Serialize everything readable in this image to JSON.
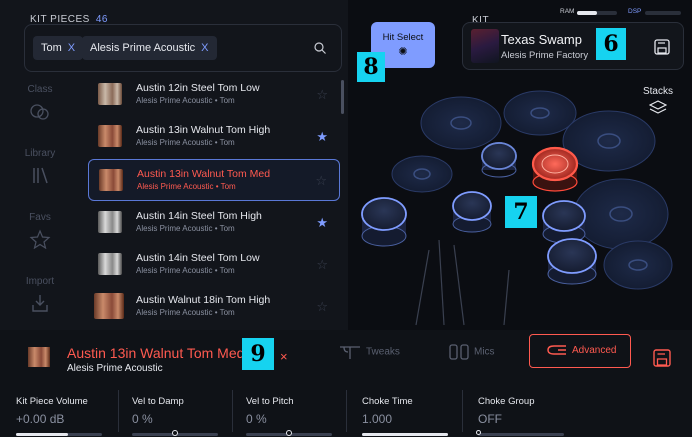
{
  "kit_pieces": {
    "header": "KIT PIECES",
    "count": "46",
    "filters": [
      {
        "label": "Tom",
        "remove": "X"
      },
      {
        "label": "Alesis Prime Acoustic",
        "remove": "X"
      }
    ],
    "sidebar": [
      {
        "label": "Class",
        "icon": "class-icon"
      },
      {
        "label": "Library",
        "icon": "library-icon"
      },
      {
        "label": "Favs",
        "icon": "star-outline-icon"
      },
      {
        "label": "Import",
        "icon": "import-icon"
      }
    ],
    "items": [
      {
        "name": "Austin 12in Steel Tom Low",
        "sub": "Alesis Prime Acoustic • Tom",
        "fav": false,
        "selected": false
      },
      {
        "name": "Austin 13in Walnut Tom High",
        "sub": "Alesis Prime Acoustic • Tom",
        "fav": true,
        "selected": false
      },
      {
        "name": "Austin 13in Walnut Tom Med",
        "sub": "Alesis Prime Acoustic • Tom",
        "fav": false,
        "selected": true
      },
      {
        "name": "Austin 14in Steel Tom High",
        "sub": "Alesis Prime Acoustic • Tom",
        "fav": true,
        "selected": false
      },
      {
        "name": "Austin 14in Steel Tom Low",
        "sub": "Alesis Prime Acoustic • Tom",
        "fav": false,
        "selected": false
      },
      {
        "name": "Austin Walnut 18in Tom High",
        "sub": "Alesis Prime Acoustic • Tom",
        "fav": false,
        "selected": false
      }
    ]
  },
  "hit_select": {
    "label": "Hit Select",
    "icon": "target-icon"
  },
  "kit": {
    "header": "KIT",
    "name": "Texas Swamp",
    "sub": "Alesis Prime Factory"
  },
  "meters": {
    "ram": "RAM",
    "ram_level": 0.5,
    "dsp": "DSP"
  },
  "stacks": {
    "label": "Stacks"
  },
  "badges": {
    "b6": "6",
    "b7": "7",
    "b8": "8",
    "b9": "9"
  },
  "selected_piece": {
    "name": "Austin 13in Walnut Tom Med",
    "sub": "Alesis Prime Acoustic",
    "close": "×"
  },
  "tabs": [
    {
      "label": "Tweaks",
      "active": false
    },
    {
      "label": "Mics",
      "active": false
    },
    {
      "label": "Advanced",
      "active": true
    }
  ],
  "params": [
    {
      "label": "Kit Piece Volume",
      "value": "+0.00 dB",
      "level": 0.6
    },
    {
      "label": "Vel to Damp",
      "value": "0 %",
      "level": 0.5
    },
    {
      "label": "Vel to Pitch",
      "value": "0 %",
      "level": 0.5
    },
    {
      "label": "Choke Time",
      "value": "1.000",
      "level": 1.0
    },
    {
      "label": "Choke Group",
      "value": "OFF",
      "level": 0.0
    }
  ],
  "colors": {
    "accent": "#7f9cff",
    "active": "#ff5a50",
    "badge": "#16d3f0"
  }
}
